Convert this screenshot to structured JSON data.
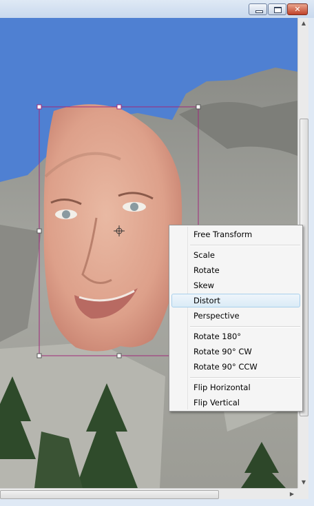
{
  "window": {
    "controls": [
      "minimize-icon",
      "maximize-icon",
      "close-icon"
    ]
  },
  "context_menu": {
    "groups": [
      [
        "Free Transform"
      ],
      [
        "Scale",
        "Rotate",
        "Skew",
        "Distort",
        "Perspective"
      ],
      [
        "Rotate 180°",
        "Rotate 90° CW",
        "Rotate 90° CCW"
      ],
      [
        "Flip Horizontal",
        "Flip Vertical"
      ]
    ],
    "highlighted": "Distort"
  },
  "colors": {
    "sky": "#4f80d2",
    "rock": "#a9aaa4",
    "selection_box": "#a0287a",
    "menu_highlight": "#daebf6"
  }
}
